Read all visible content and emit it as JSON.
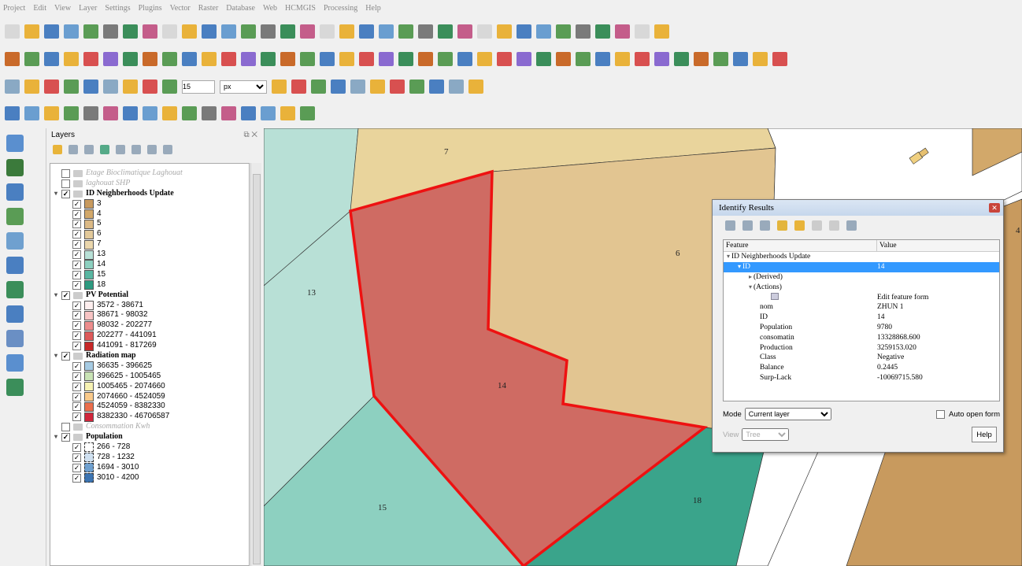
{
  "menu": [
    "Project",
    "Edit",
    "View",
    "Layer",
    "Settings",
    "Plugins",
    "Vector",
    "Raster",
    "Database",
    "Web",
    "HCMGIS",
    "Processing",
    "Help"
  ],
  "toolbar": {
    "snap_tolerance": "15",
    "unit": "px"
  },
  "layers_panel": {
    "title": "Layers",
    "groups": [
      {
        "type": "dim",
        "label": "Etage Bioclimatique Laghouat"
      },
      {
        "type": "dim",
        "label": "laghouat SHP"
      },
      {
        "type": "group",
        "label": "ID Neighberhoods Update"
      },
      {
        "type": "item",
        "label": "3",
        "color": "#c89a5e"
      },
      {
        "type": "item",
        "label": "4",
        "color": "#d2a86a"
      },
      {
        "type": "item",
        "label": "5",
        "color": "#dbb985"
      },
      {
        "type": "item",
        "label": "6",
        "color": "#e2c99a"
      },
      {
        "type": "item",
        "label": "7",
        "color": "#ead6ac"
      },
      {
        "type": "item",
        "label": "13",
        "color": "#b8e0d6"
      },
      {
        "type": "item",
        "label": "14",
        "color": "#8dd0c0"
      },
      {
        "type": "item",
        "label": "15",
        "color": "#59b6a1"
      },
      {
        "type": "item",
        "label": "18",
        "color": "#2e9a80"
      },
      {
        "type": "group",
        "label": "PV Potential"
      },
      {
        "type": "item",
        "label": "3572 - 38671",
        "color": "#fdeeee"
      },
      {
        "type": "item",
        "label": "38671 - 98032",
        "color": "#f7c4c4"
      },
      {
        "type": "item",
        "label": "98032 - 202277",
        "color": "#ec8c8c"
      },
      {
        "type": "item",
        "label": "202277 - 441091",
        "color": "#dd5a5a"
      },
      {
        "type": "item",
        "label": "441091 - 817269",
        "color": "#c62828"
      },
      {
        "type": "group",
        "label": "Radiation map"
      },
      {
        "type": "item",
        "label": "36635 - 396625",
        "color": "#a6cbe3"
      },
      {
        "type": "item",
        "label": "396625 - 1005465",
        "color": "#c9e3b5"
      },
      {
        "type": "item",
        "label": "1005465 - 2074660",
        "color": "#f7f2b3"
      },
      {
        "type": "item",
        "label": "2074660 - 4524059",
        "color": "#f9c98a"
      },
      {
        "type": "item",
        "label": "4524059 - 8382330",
        "color": "#ea6e4c"
      },
      {
        "type": "item",
        "label": "8382330 - 46706587",
        "color": "#d0263b"
      },
      {
        "type": "dim",
        "label": "Consommation Kwh"
      },
      {
        "type": "group",
        "label": "Population"
      },
      {
        "type": "item",
        "label": "266 - 728",
        "color": "#ffffff",
        "dashed": true
      },
      {
        "type": "item",
        "label": "728 - 1232",
        "color": "#cfe0f0",
        "dashed": true
      },
      {
        "type": "item",
        "label": "1694 - 3010",
        "color": "#6fa0cf",
        "dashed": true
      },
      {
        "type": "item",
        "label": "3010 - 4200",
        "color": "#3d74b1",
        "dashed": true
      }
    ]
  },
  "map": {
    "labels": [
      {
        "id": "lbl-7",
        "text": "7"
      },
      {
        "id": "lbl-6",
        "text": "6"
      },
      {
        "id": "lbl-13",
        "text": "13"
      },
      {
        "id": "lbl-14",
        "text": "14"
      },
      {
        "id": "lbl-15",
        "text": "15"
      },
      {
        "id": "lbl-18",
        "text": "18"
      },
      {
        "id": "lbl-4",
        "text": "4"
      }
    ]
  },
  "identify": {
    "title": "Identify Results",
    "col_feature": "Feature",
    "col_value": "Value",
    "rows": [
      {
        "f": "ID Neighberhoods Update",
        "v": "",
        "indent": 0,
        "arrow": "▾"
      },
      {
        "f": "ID",
        "v": "14",
        "indent": 1,
        "arrow": "▾",
        "sel": true
      },
      {
        "f": "(Derived)",
        "v": "",
        "indent": 2,
        "arrow": "▸"
      },
      {
        "f": "(Actions)",
        "v": "",
        "indent": 2,
        "arrow": "▾"
      },
      {
        "f": "",
        "v": "Edit feature form",
        "indent": 4,
        "arrow": "",
        "icon": true
      },
      {
        "f": "nom",
        "v": "ZHUN 1",
        "indent": 3,
        "arrow": ""
      },
      {
        "f": "ID",
        "v": "14",
        "indent": 3,
        "arrow": ""
      },
      {
        "f": "Population",
        "v": "9780",
        "indent": 3,
        "arrow": ""
      },
      {
        "f": "consomatin",
        "v": "13328868.600",
        "indent": 3,
        "arrow": ""
      },
      {
        "f": "Production",
        "v": "3259153.020",
        "indent": 3,
        "arrow": ""
      },
      {
        "f": "Class",
        "v": "Negative",
        "indent": 3,
        "arrow": ""
      },
      {
        "f": "Balance",
        "v": "0.2445",
        "indent": 3,
        "arrow": ""
      },
      {
        "f": "Surp-Lack",
        "v": "-10069715.580",
        "indent": 3,
        "arrow": ""
      }
    ],
    "mode_label": "Mode",
    "mode_value": "Current layer",
    "auto_open": "Auto open form",
    "view_label": "View",
    "view_value": "Tree",
    "help": "Help"
  }
}
